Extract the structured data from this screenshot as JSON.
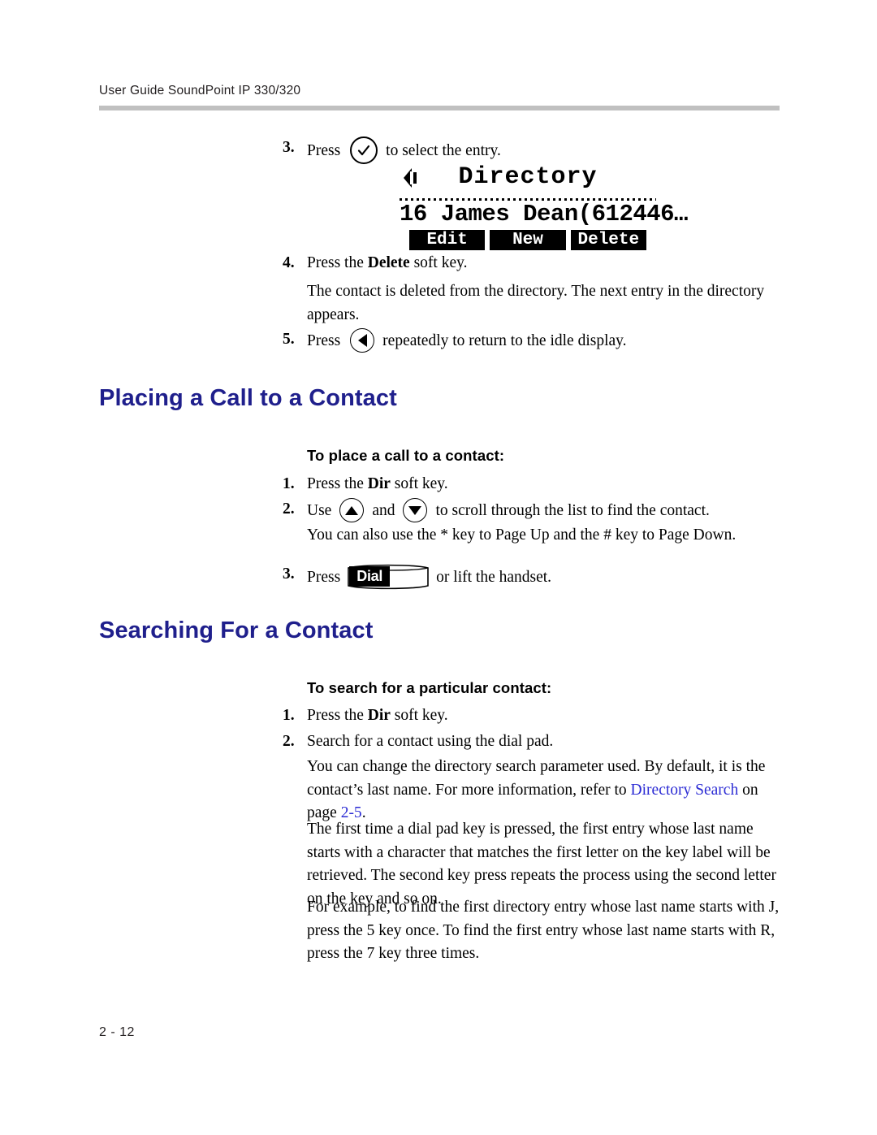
{
  "header": {
    "running_head": "User Guide SoundPoint IP 330/320"
  },
  "footer": {
    "page_number": "2 - 12"
  },
  "colors": {
    "heading_blue": "#1f1f8c",
    "link_blue": "#2b2bd4",
    "rule_gray": "#c0c0c0"
  },
  "top_steps": {
    "step3": {
      "num": "3.",
      "text_before": "Press",
      "icon": "select-check-circle-icon",
      "text_after": "to select the entry."
    },
    "step4": {
      "num": "4.",
      "text_before": "Press the ",
      "bold_word": "Delete",
      "text_after": " soft key.",
      "note": "The contact is deleted from the directory. The next entry in the directory appears."
    },
    "step5": {
      "num": "5.",
      "text_before": "Press",
      "icon": "left-arrow-circle-icon",
      "text_after": "repeatedly to return to the idle display."
    }
  },
  "lcd": {
    "status_icon": "handset-left-arrow-icon",
    "title": "Directory",
    "entry": "16 James Dean(612446…",
    "softkeys": [
      "Edit",
      "New",
      "Delete"
    ]
  },
  "section_placing": {
    "heading": "Placing a Call to a Contact",
    "subheading": "To place a call to a contact:",
    "steps": [
      {
        "num": "1.",
        "text_before": "Press the ",
        "bold_word": "Dir",
        "text_after": " soft key."
      },
      {
        "num": "2.",
        "text_before": "Use",
        "icon_up": "arrow-up-circle-icon",
        "middle": "and",
        "icon_down": "arrow-down-circle-icon",
        "text_after": "to scroll through the list to find the contact.",
        "note": "You can also use the * key to Page Up and the # key to Page Down."
      },
      {
        "num": "3.",
        "text_before": "Press",
        "key_label": "Dial",
        "text_after": "or lift the handset."
      }
    ]
  },
  "section_searching": {
    "heading": "Searching For a Contact",
    "subheading": "To search for a particular contact:",
    "steps": [
      {
        "num": "1.",
        "text_before": "Press the ",
        "bold_word": "Dir",
        "text_after": " soft key."
      },
      {
        "num": "2.",
        "text": "Search for a contact using the dial pad."
      }
    ],
    "paragraphs": {
      "p1_part1": "You can change the directory search parameter used. By default, it is the contact’s last name. For more information, refer to ",
      "p1_link1": "Directory Search",
      "p1_part2": " on page ",
      "p1_link2": "2-5",
      "p1_part3": ".",
      "p2": "The first time a dial pad key is pressed, the first entry whose last name starts with a character that matches the first letter on the key label will be retrieved. The second key press repeats the process using the second letter on the key and so on.",
      "p3": "For example, to find the first directory entry whose last name starts with J, press the 5 key once. To find the first entry whose last name starts with R, press the 7 key three times."
    }
  }
}
